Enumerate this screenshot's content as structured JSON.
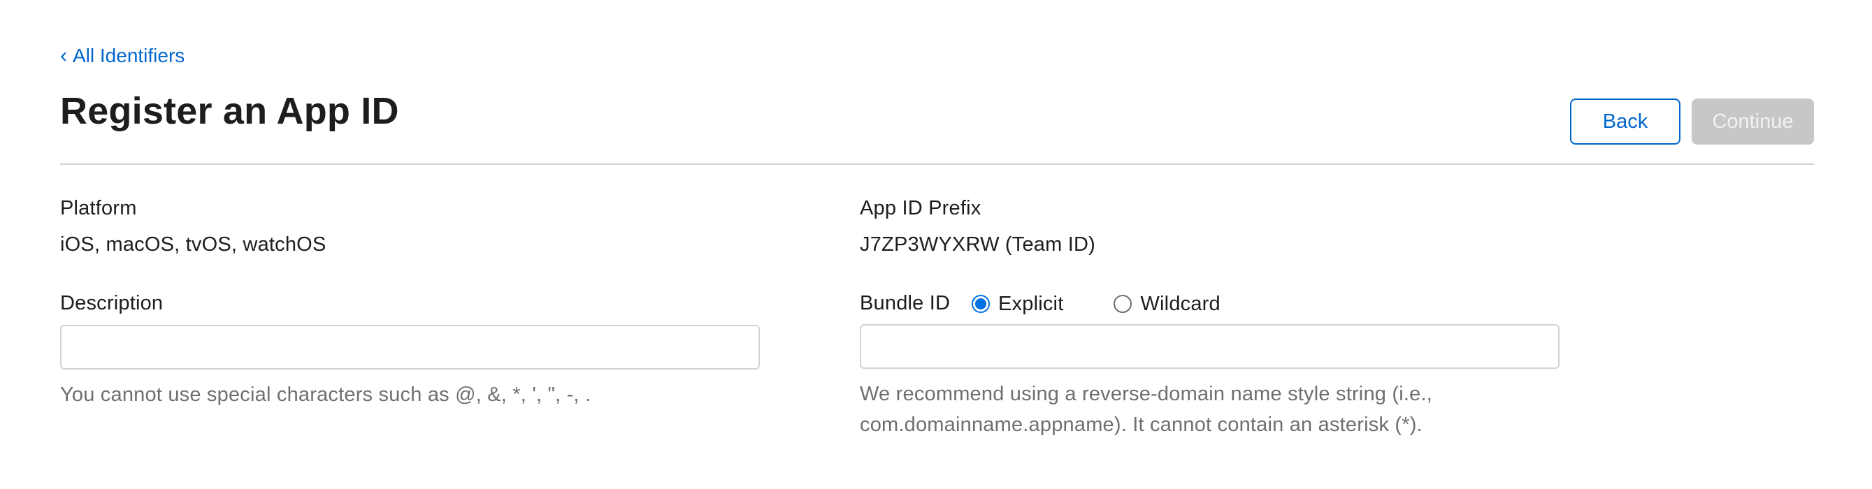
{
  "nav": {
    "back_link": "All Identifiers"
  },
  "header": {
    "title": "Register an App ID",
    "back_button": "Back",
    "continue_button": "Continue"
  },
  "form": {
    "platform": {
      "label": "Platform",
      "value": "iOS, macOS, tvOS, watchOS"
    },
    "app_id_prefix": {
      "label": "App ID Prefix",
      "value": "J7ZP3WYXRW (Team ID)"
    },
    "description": {
      "label": "Description",
      "value": "",
      "placeholder": "",
      "help": "You cannot use special characters such as @, &, *, ', \", -, ."
    },
    "bundle_id": {
      "label": "Bundle ID",
      "options": [
        {
          "label": "Explicit",
          "selected": true
        },
        {
          "label": "Wildcard",
          "selected": false
        }
      ],
      "value": "",
      "placeholder": "",
      "help_line1": "We recommend using a reverse-domain name style string (i.e.,",
      "help_line2": "com.domainname.appname). It cannot contain an asterisk (*)."
    }
  },
  "colors": {
    "link": "#0066cc",
    "radio_accent": "#0071e3",
    "disabled_button": "#c7c7c7",
    "help_text": "#6e6e73",
    "border": "#d2d2d7"
  }
}
